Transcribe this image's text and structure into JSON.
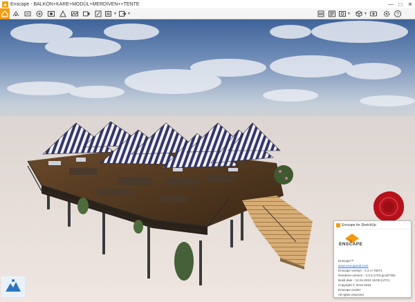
{
  "window": {
    "title": "Enscape - BALKON+KARE+MODÜL+MERDIVEN++TENTE"
  },
  "toolbar": {
    "left_buttons": [
      "home-icon",
      "sync-icon",
      "link-icon",
      "fps-icon",
      "capture-icon",
      "render-icon",
      "panorama-icon",
      "video-icon",
      "screenshot-icon",
      "layers-icon",
      "export-icon"
    ],
    "right_buttons": [
      "object-library-icon",
      "asset-icon",
      "material-icon",
      "visual-settings-icon",
      "feedback-icon",
      "settings-icon",
      "help-icon"
    ]
  },
  "about": {
    "header": "Enscape for SketchUp",
    "brand": "ENSCAPE",
    "lines": [
      "Enscape™",
      "www.enscape3d.com",
      "Enscape version - 3.3.1+75071",
      "Renderer version - 3.3.0.1723-gc4d730e",
      "Build date - 12.04.2022 15:08 (UTC)",
      "Copyright © 2013-2022",
      "Enscape GmbH",
      "All rights reserved"
    ],
    "link_index": 1
  },
  "colors": {
    "accent": "#f39c12",
    "sky_top": "#3a5f95",
    "sky_bottom": "#c8d3e0",
    "ground": "#e6dcd6",
    "canopy_stripe": "#3a3d6b",
    "wood": "#d9b07a",
    "wax_seal": "#b5121b"
  }
}
